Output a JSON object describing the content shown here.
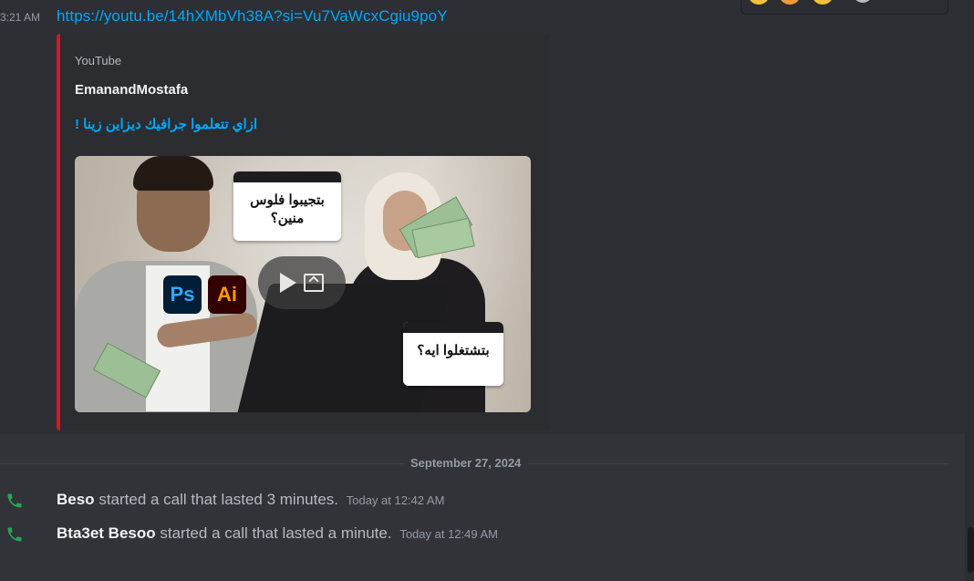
{
  "message": {
    "timestamp": "3:21 AM",
    "link_text": "https://youtu.be/14hXMbVh38A?si=Vu7VaWcxCgiu9poY",
    "embed": {
      "provider": "YouTube",
      "author": "EmanandMostafa",
      "title": "ازاي تتعلموا جرافيك ديزاين زينا !",
      "thumbnail": {
        "bubble_top": "بتجيبوا فلوس منين؟",
        "bubble_bottom": "بتشتغلوا ايه؟",
        "photoshop_label": "Ps",
        "illustrator_label": "Ai",
        "play_icon": "play-icon",
        "open_icon": "open-external-icon"
      },
      "accent_color": "#e0141e"
    }
  },
  "date_divider": "September 27, 2024",
  "calls": [
    {
      "user": "Beso",
      "text": "started a call that lasted 3 minutes.",
      "time": "Today at 12:42 AM"
    },
    {
      "user": "Bta3et Besoo",
      "text": "started a call that lasted a minute.",
      "time": "Today at 12:49 AM"
    }
  ],
  "colors": {
    "link": "#00a8fc",
    "phone_icon": "#23a55a",
    "background": "#323339"
  }
}
